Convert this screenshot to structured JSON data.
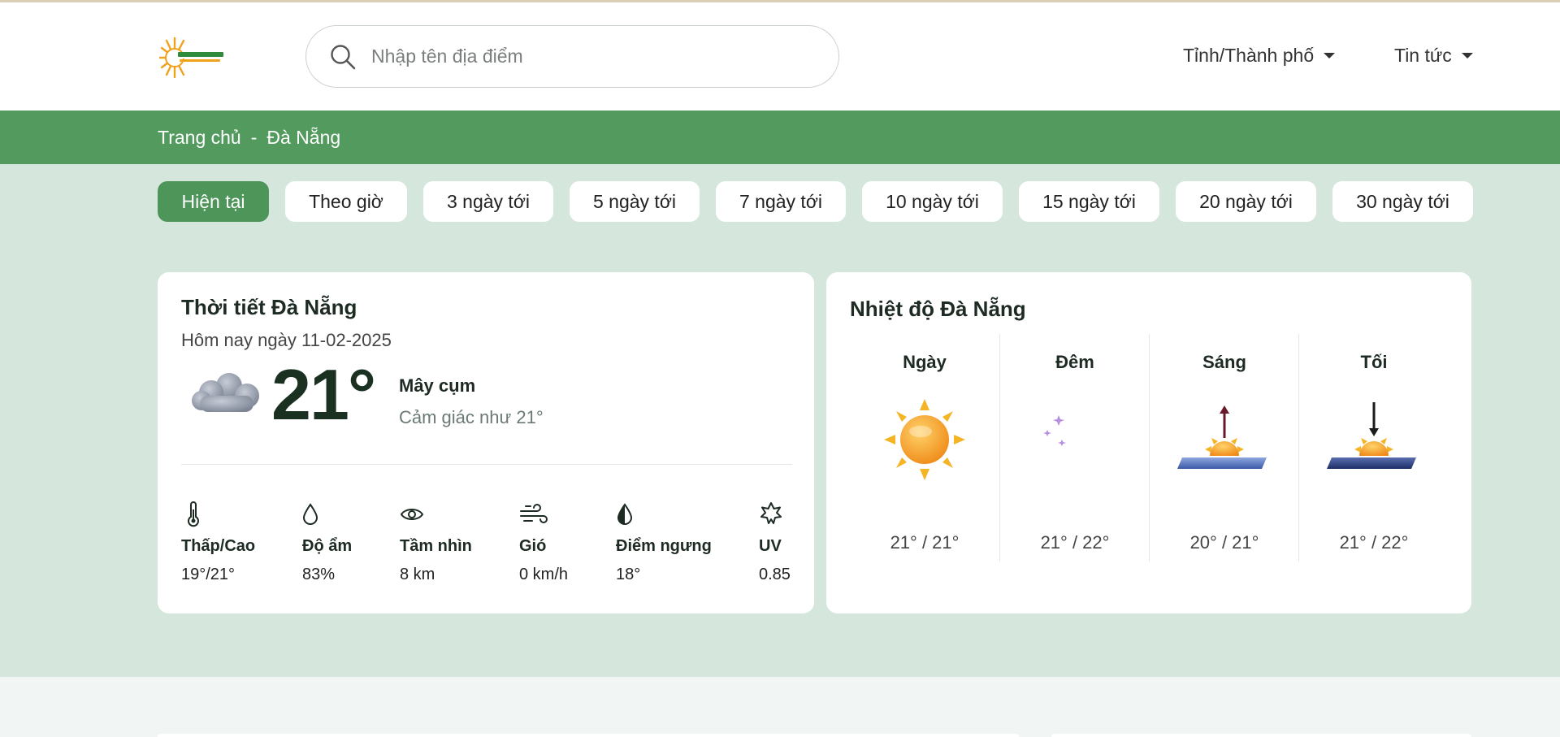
{
  "header": {
    "logo_name": "sun-logo",
    "search_placeholder": "Nhập tên địa điểm",
    "nav": [
      {
        "label": "Tỉnh/Thành phố"
      },
      {
        "label": "Tin tức"
      }
    ]
  },
  "breadcrumb": {
    "home": "Trang chủ",
    "separator": "-",
    "current": "Đà Nẵng"
  },
  "tabs": [
    {
      "label": "Hiện tại",
      "active": true
    },
    {
      "label": "Theo giờ"
    },
    {
      "label": "3 ngày tới"
    },
    {
      "label": "5 ngày tới"
    },
    {
      "label": "7 ngày tới"
    },
    {
      "label": "10 ngày tới"
    },
    {
      "label": "15 ngày tới"
    },
    {
      "label": "20 ngày tới"
    },
    {
      "label": "30 ngày tới"
    }
  ],
  "current": {
    "title": "Thời tiết Đà Nẵng",
    "date": "Hôm nay ngày 11-02-2025",
    "temp": "21°",
    "condition": "Mây cụm",
    "feels_like": "Cảm giác như 21°",
    "icon": "cloud-icon",
    "metrics": [
      {
        "icon": "thermometer-icon",
        "label": "Thấp/Cao",
        "value": "19°/21°"
      },
      {
        "icon": "droplet-icon",
        "label": "Độ ẩm",
        "value": "83%"
      },
      {
        "icon": "eye-icon",
        "label": "Tầm nhìn",
        "value": "8 km"
      },
      {
        "icon": "wind-icon",
        "label": "Gió",
        "value": "0 km/h"
      },
      {
        "icon": "dewpoint-icon",
        "label": "Điểm ngưng",
        "value": "18°"
      },
      {
        "icon": "uv-sun-icon",
        "label": "UV",
        "value": "0.85"
      }
    ]
  },
  "temperature": {
    "title": "Nhiệt độ Đà Nẵng",
    "periods": [
      {
        "name": "Ngày",
        "icon": "sun-icon",
        "temp": "21° / 21°"
      },
      {
        "name": "Đêm",
        "icon": "moon-icon",
        "temp": "21° / 22°"
      },
      {
        "name": "Sáng",
        "icon": "sunrise-icon",
        "temp": "20° / 21°"
      },
      {
        "name": "Tối",
        "icon": "sunset-icon",
        "temp": "21° / 22°"
      }
    ]
  },
  "colors": {
    "green_bar": "#539a5f",
    "band": "#d5e7dc",
    "active_tab": "#4e9559"
  }
}
